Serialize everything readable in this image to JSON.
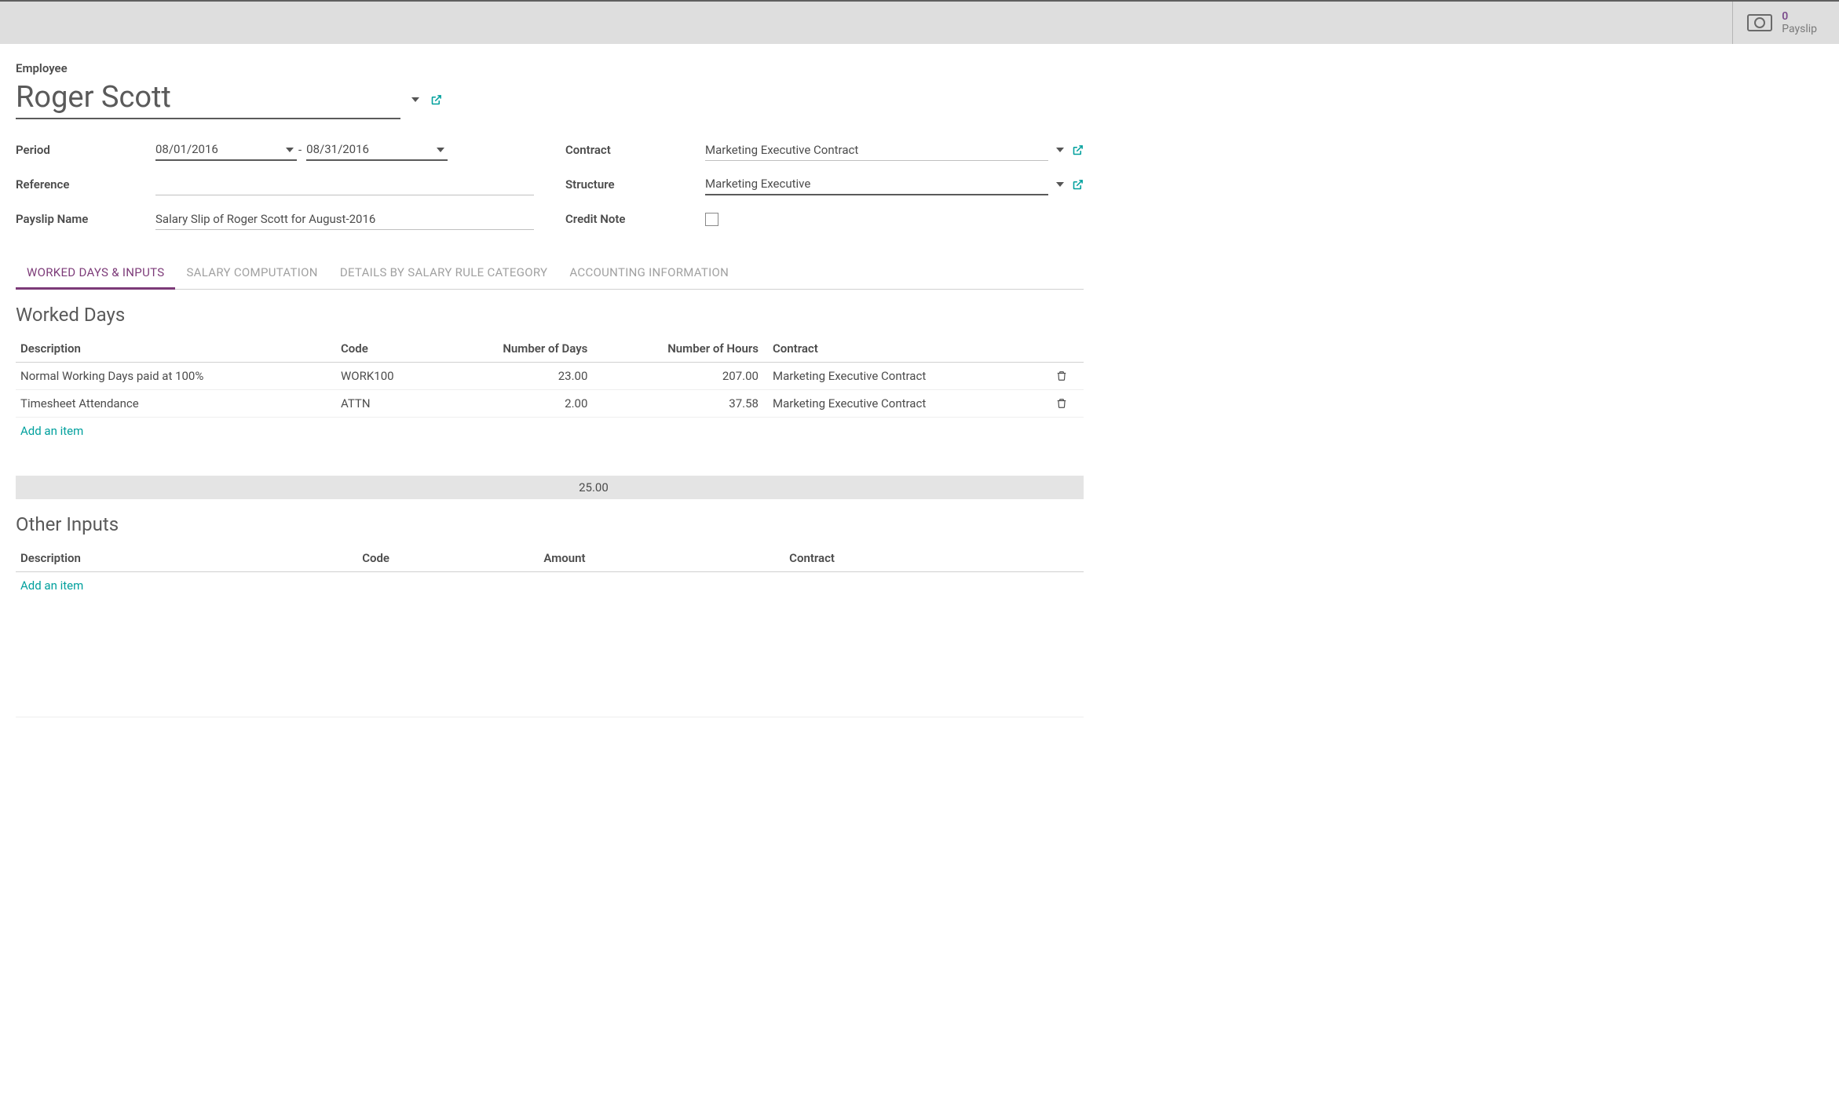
{
  "header": {
    "stat_count": "0",
    "stat_label": "Payslip"
  },
  "form": {
    "employee_label": "Employee",
    "employee_value": "Roger Scott",
    "period_label": "Period",
    "period_from": "08/01/2016",
    "period_sep": "-",
    "period_to": "08/31/2016",
    "reference_label": "Reference",
    "reference_value": "",
    "payslip_name_label": "Payslip Name",
    "payslip_name_value": "Salary Slip of Roger Scott for August-2016",
    "contract_label": "Contract",
    "contract_value": "Marketing Executive Contract",
    "structure_label": "Structure",
    "structure_value": "Marketing Executive",
    "credit_note_label": "Credit Note"
  },
  "tabs": {
    "t1": "WORKED DAYS & INPUTS",
    "t2": "SALARY COMPUTATION",
    "t3": "DETAILS BY SALARY RULE CATEGORY",
    "t4": "ACCOUNTING INFORMATION"
  },
  "worked_days": {
    "title": "Worked Days",
    "cols": {
      "desc": "Description",
      "code": "Code",
      "days": "Number of Days",
      "hours": "Number of Hours",
      "contract": "Contract"
    },
    "rows": [
      {
        "desc": "Normal Working Days paid at 100%",
        "code": "WORK100",
        "days": "23.00",
        "hours": "207.00",
        "contract": "Marketing Executive Contract"
      },
      {
        "desc": "Timesheet Attendance",
        "code": "ATTN",
        "days": "2.00",
        "hours": "37.58",
        "contract": "Marketing Executive Contract"
      }
    ],
    "add": "Add an item",
    "total_days": "25.00"
  },
  "other_inputs": {
    "title": "Other Inputs",
    "cols": {
      "desc": "Description",
      "code": "Code",
      "amount": "Amount",
      "contract": "Contract"
    },
    "add": "Add an item"
  }
}
